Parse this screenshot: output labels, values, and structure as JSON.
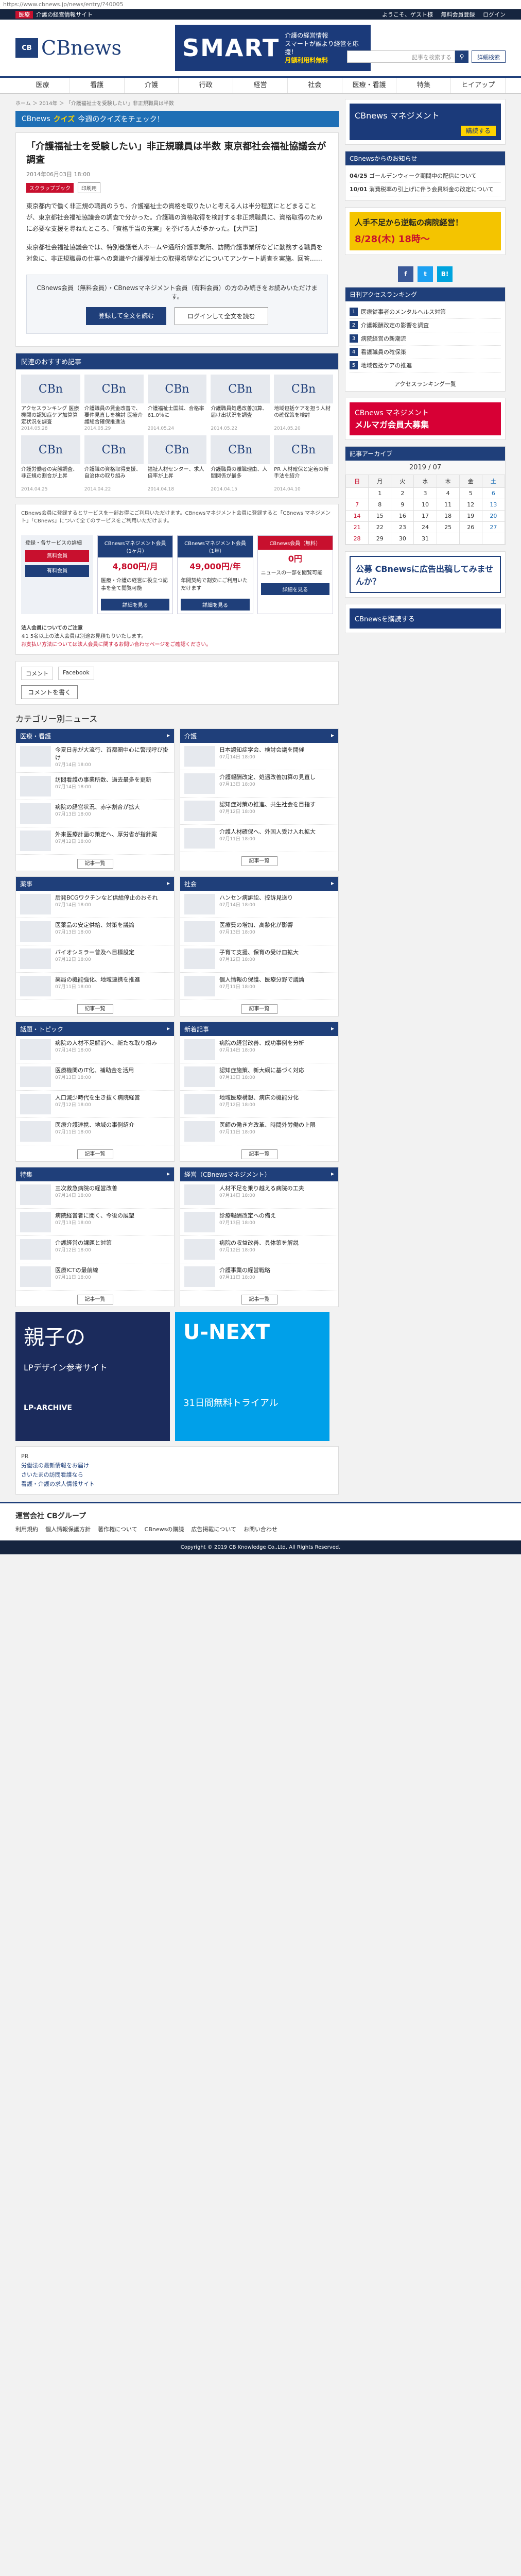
{
  "url": "https://www.cbnews.jp/news/entry/?40005",
  "top": {
    "tag": "医療",
    "title": "介護の経営情報サイト",
    "links": [
      "ようこそ、ゲスト様",
      "無料会員登録",
      "ログイン"
    ]
  },
  "logo": {
    "mark": "CB",
    "name": "CBnews",
    "sub": ""
  },
  "smart_ad": {
    "big": "SMART",
    "line1": "介護の経営情報",
    "line2": "スマートが誰より経営を応援！",
    "line3": "月額利用料無料"
  },
  "search": {
    "placeholder": "記事を検索する",
    "advanced": "詳細検索"
  },
  "nav": [
    "医療",
    "看護",
    "介護",
    "行政",
    "経営",
    "社会",
    "医療・看護",
    "特集",
    "ヒイアップ"
  ],
  "breadcrumb": "ホーム ＞ 2014年 ＞ 「介護福祉士を受験したい」非正規職員は半数",
  "promo": {
    "pre": "CBnews",
    "quiz": "クイズ",
    "text": "今週のクイズをチェック！"
  },
  "article": {
    "title": "「介護福祉士を受験したい」非正規職員は半数 東京都社会福祉協議会が調査",
    "date": "2014年06月03日 18:00",
    "tags": [
      "スクラップブック",
      "印刷用"
    ],
    "p1": "東京都内で働く非正規の職員のうち、介護福祉士の資格を取りたいと考える人は半分程度にとどまることが、東京都社会福祉協議会の調査で分かった。介護職の資格取得を検討する非正規職員に、資格取得のために必要な支援を尋ねたところ、「資格手当の充実」を挙げる人が多かった。【大戸正】",
    "p2": "東京都社会福祉協議会では、特別養護老人ホームや通所介護事業所、訪問介護事業所などに勤務する職員を対象に、非正規職員の仕事への意識や介護福祉士の取得希望などについてアンケート調査を実施。回答……",
    "register": "CBnews会員（無料会員）・CBnewsマネジメント会員（有料会員）の方のみ続きをお読みいただけます。",
    "btn_login": "登録して全文を読む",
    "btn_guest": "ログインして全文を読む"
  },
  "related": {
    "title": "関連のおすすめ記事",
    "items": [
      {
        "cap": "アクセスランキング 医療機関の認知症ケア加算算定状況を調査",
        "d": "2014.05.28"
      },
      {
        "cap": "介護職員の賃金改善で、要件見直しを検討 医療介護総合確保推進法",
        "d": "2014.05.29"
      },
      {
        "cap": "介護福祉士国試、合格率61.0％に",
        "d": "2014.05.24"
      },
      {
        "cap": "介護職員処遇改善加算、届け出状況を調査",
        "d": "2014.05.22"
      },
      {
        "cap": "地域包括ケアを担う人材の確保策を検討",
        "d": "2014.05.20"
      },
      {
        "cap": "介護労働者の実態調査、非正規の割合が上昇",
        "d": "2014.04.25"
      },
      {
        "cap": "介護職の資格取得支援、自治体の取り組み",
        "d": "2014.04.22"
      },
      {
        "cap": "福祉人材センター、求人倍率が上昇",
        "d": "2014.04.18"
      },
      {
        "cap": "介護職員の離職理由、人間関係が最多",
        "d": "2014.04.15"
      },
      {
        "cap": "PR 人材確保と定着の新手法を紹介",
        "d": "2014.04.10"
      }
    ]
  },
  "plans": {
    "note": "CBnews会員に登録するとサービスを一部お得にご利用いただけます。CBnewsマネジメント会員に登録すると「CBnews マネジメント」「CBnews」について全てのサービスをご利用いただけます。",
    "left": {
      "title": "登録・各サービスの詳細",
      "btn1": "無料会員",
      "btn2": "有料会員"
    },
    "cols": [
      {
        "head": "CBnewsマネジメント会員（1ヶ月）",
        "price": "4,800円/月",
        "body": "医療・介護の経営に役立つ記事を全て閲覧可能"
      },
      {
        "head": "CBnewsマネジメント会員（1年）",
        "price": "49,000円/年",
        "body": "年間契約で割安にご利用いただけます"
      },
      {
        "head": "CBnews会員（無料）",
        "price": "0円",
        "body": "ニュースの一部を閲覧可能"
      }
    ],
    "btn": "詳細を見る"
  },
  "payment": {
    "title": "法人会員についてのご注意",
    "l1": "※1 5名以上の法人会員は別途お見積もりいたします。",
    "warn": "お支払い方法については法人会員に関するお問い合わせページをご確認ください。"
  },
  "comments": {
    "tab1": "コメント",
    "tab2": "Facebook",
    "btn": "コメントを書く"
  },
  "categories": {
    "title": "カテゴリー別ニュース",
    "blocks": [
      {
        "name": "医療・看護",
        "items": [
          {
            "t": "今夏日赤が大流行、首都圏中心に警戒呼び掛け",
            "d": "07月14日 18:00"
          },
          {
            "t": "訪問看護の事業所数、過去最多を更新",
            "d": "07月14日 18:00"
          },
          {
            "t": "病院の経営状況、赤字割合が拡大",
            "d": "07月13日 18:00"
          },
          {
            "t": "外来医療計画の策定へ、厚労省が指針案",
            "d": "07月12日 18:00"
          }
        ],
        "more": "記事一覧"
      },
      {
        "name": "介護",
        "items": [
          {
            "t": "日本認知症学会、検討会議を開催",
            "d": "07月14日 18:00"
          },
          {
            "t": "介護報酬改定、処遇改善加算の見直し",
            "d": "07月13日 18:00"
          },
          {
            "t": "認知症対策の推進、共生社会を目指す",
            "d": "07月12日 18:00"
          },
          {
            "t": "介護人材確保へ、外国人受け入れ拡大",
            "d": "07月11日 18:00"
          }
        ],
        "more": "記事一覧"
      },
      {
        "name": "薬事",
        "items": [
          {
            "t": "后発BCGワクチンなど供給停止のおそれ",
            "d": "07月14日 18:00"
          },
          {
            "t": "医薬品の安定供給、対策を議論",
            "d": "07月13日 18:00"
          },
          {
            "t": "バイオシミラー普及へ目標設定",
            "d": "07月12日 18:00"
          },
          {
            "t": "薬局の機能強化、地域連携を推進",
            "d": "07月11日 18:00"
          }
        ],
        "more": "記事一覧"
      },
      {
        "name": "社会",
        "items": [
          {
            "t": "ハンセン病訴訟、控訴見送り",
            "d": "07月14日 18:00"
          },
          {
            "t": "医療費の増加、高齢化が影響",
            "d": "07月13日 18:00"
          },
          {
            "t": "子育て支援、保育の受け皿拡大",
            "d": "07月12日 18:00"
          },
          {
            "t": "個人情報の保護、医療分野で議論",
            "d": "07月11日 18:00"
          }
        ],
        "more": "記事一覧"
      },
      {
        "name": "話題・トピック",
        "items": [
          {
            "t": "病院の人材不足解消へ、新たな取り組み",
            "d": "07月14日 18:00"
          },
          {
            "t": "医療機関のIT化、補助金を活用",
            "d": "07月13日 18:00"
          },
          {
            "t": "人口減少時代を生き抜く病院経営",
            "d": "07月12日 18:00"
          },
          {
            "t": "医療介護連携、地域の事例紹介",
            "d": "07月11日 18:00"
          }
        ],
        "more": "記事一覧"
      },
      {
        "name": "新着記事",
        "items": [
          {
            "t": "病院の経営改善、成功事例を分析",
            "d": "07月14日 18:00"
          },
          {
            "t": "認知症施策、新大綱に基づく対応",
            "d": "07月13日 18:00"
          },
          {
            "t": "地域医療構想、病床の機能分化",
            "d": "07月12日 18:00"
          },
          {
            "t": "医師の働き方改革、時間外労働の上限",
            "d": "07月11日 18:00"
          }
        ],
        "more": "記事一覧"
      },
      {
        "name": "特集",
        "items": [
          {
            "t": "三次救急病院の経営改善",
            "d": "07月14日 18:00"
          },
          {
            "t": "病院経営者に聞く、今後の展望",
            "d": "07月13日 18:00"
          },
          {
            "t": "介護経営の課題と対策",
            "d": "07月12日 18:00"
          },
          {
            "t": "医療ICTの最前線",
            "d": "07月11日 18:00"
          }
        ],
        "more": "記事一覧"
      },
      {
        "name": "経営（CBnewsマネジメント）",
        "items": [
          {
            "t": "人材不足を乗り越える病院の工夫",
            "d": "07月14日 18:00"
          },
          {
            "t": "診療報酬改定への備え",
            "d": "07月13日 18:00"
          },
          {
            "t": "病院の収益改善、具体策を解説",
            "d": "07月12日 18:00"
          },
          {
            "t": "介護事業の経営戦略",
            "d": "07月11日 18:00"
          }
        ],
        "more": "記事一覧"
      }
    ]
  },
  "bottom_ads": {
    "ad1": {
      "title": "親子の",
      "sub": "LPデザイン参考サイト",
      "foot": "LP-ARCHIVE"
    },
    "ad2": {
      "title": "U-NEXT",
      "sub": "31日間無料トライアル"
    }
  },
  "pr": {
    "title": "PR",
    "links": [
      "労働法の最新情報をお届け",
      "さいたまの訪問看護なら",
      "看護・介護の求人情報サイト"
    ]
  },
  "side": {
    "ad1": {
      "title": "CBnews マネジメント",
      "btn": "購読する"
    },
    "news_title": "CBnewsからのお知らせ",
    "news": [
      {
        "d": "04/25",
        "t": "ゴールデンウィーク期間中の配信について"
      },
      {
        "d": "10/01",
        "t": "消費税率の引上げに伴う会員料金の改定について"
      }
    ],
    "ad2": {
      "title": "人手不足から逆転の病院経営！",
      "date": "8/28(木) 18時〜"
    },
    "rank_title": "日刊アクセスランキング",
    "rank": [
      "医療従事者のメンタルヘルス対策",
      "介護報酬改定の影響を調査",
      "病院経営の新潮流",
      "看護職員の確保策",
      "地域包括ケアの推進"
    ],
    "rank_more": "アクセスランキング一覧",
    "ad3": {
      "title": "CBnews マネジメント",
      "sub": "メルマガ会員大募集"
    },
    "cal_title": "記事アーカイブ",
    "cal_month": "2019 / 07",
    "weekdays": [
      "日",
      "月",
      "火",
      "水",
      "木",
      "金",
      "土"
    ],
    "weeks": [
      [
        "",
        "1",
        "2",
        "3",
        "4",
        "5",
        "6"
      ],
      [
        "7",
        "8",
        "9",
        "10",
        "11",
        "12",
        "13"
      ],
      [
        "14",
        "15",
        "16",
        "17",
        "18",
        "19",
        "20"
      ],
      [
        "21",
        "22",
        "23",
        "24",
        "25",
        "26",
        "27"
      ],
      [
        "28",
        "29",
        "30",
        "31",
        "",
        "",
        ""
      ]
    ],
    "ad4": {
      "title": "公募 CBnewsに広告出稿してみませんか？"
    },
    "rss": "CBnewsを購読する"
  },
  "footer": {
    "title": "運営会社 CBグループ",
    "links": [
      "利用規約",
      "個人情報保護方針",
      "著作権について",
      "CBnewsの購読",
      "広告掲載について",
      "お問い合わせ"
    ],
    "copy": "Copyright © 2019 CB Knowledge Co.,Ltd. All Rights Reserved."
  }
}
